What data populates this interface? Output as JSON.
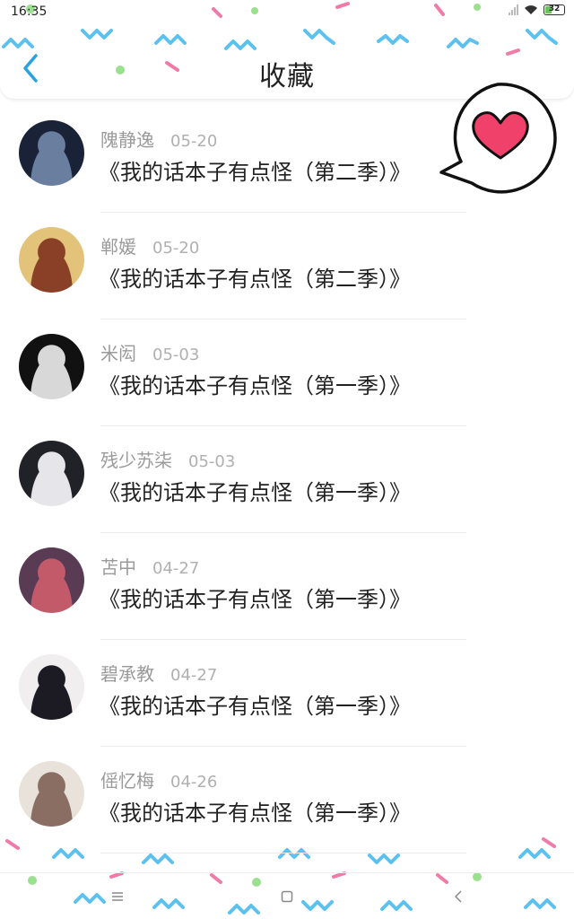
{
  "status_bar": {
    "time": "16:35",
    "battery": "32"
  },
  "header": {
    "title": "收藏",
    "back_icon": "chevron-left-icon"
  },
  "favorite_badge": {
    "icon": "heart-icon",
    "color": "#f0416a"
  },
  "items": [
    {
      "name": "隗静逸",
      "date": "05-20",
      "title": "《我的话本子有点怪（第二季）》",
      "avatar_colors": [
        "#1a2238",
        "#6a7ea0"
      ]
    },
    {
      "name": "郸媛",
      "date": "05-20",
      "title": "《我的话本子有点怪（第二季）》",
      "avatar_colors": [
        "#e3c27a",
        "#8a3f27"
      ]
    },
    {
      "name": "米闳",
      "date": "05-03",
      "title": "《我的话本子有点怪（第一季）》",
      "avatar_colors": [
        "#111111",
        "#d8d8d8"
      ]
    },
    {
      "name": "残少苏柒",
      "date": "05-03",
      "title": "《我的话本子有点怪（第一季）》",
      "avatar_colors": [
        "#202228",
        "#e6e6ea"
      ]
    },
    {
      "name": "苫中",
      "date": "04-27",
      "title": "《我的话本子有点怪（第一季）》",
      "avatar_colors": [
        "#5a3b54",
        "#c25a6a"
      ]
    },
    {
      "name": "碧承教",
      "date": "04-27",
      "title": "《我的话本子有点怪（第一季）》",
      "avatar_colors": [
        "#f1eef0",
        "#1c1a22"
      ]
    },
    {
      "name": "傜忆梅",
      "date": "04-26",
      "title": "《我的话本子有点怪（第一季）》",
      "avatar_colors": [
        "#e8e2da",
        "#8a6e64"
      ]
    }
  ],
  "nav_bar": {
    "menu_icon": "menu-icon",
    "home_icon": "square-icon",
    "back_icon": "back-icon"
  },
  "colors": {
    "accent": "#29a3e0",
    "confetti_blue": "#5cc1ef",
    "confetti_pink": "#f07aa8",
    "confetti_green": "#9be08e"
  }
}
